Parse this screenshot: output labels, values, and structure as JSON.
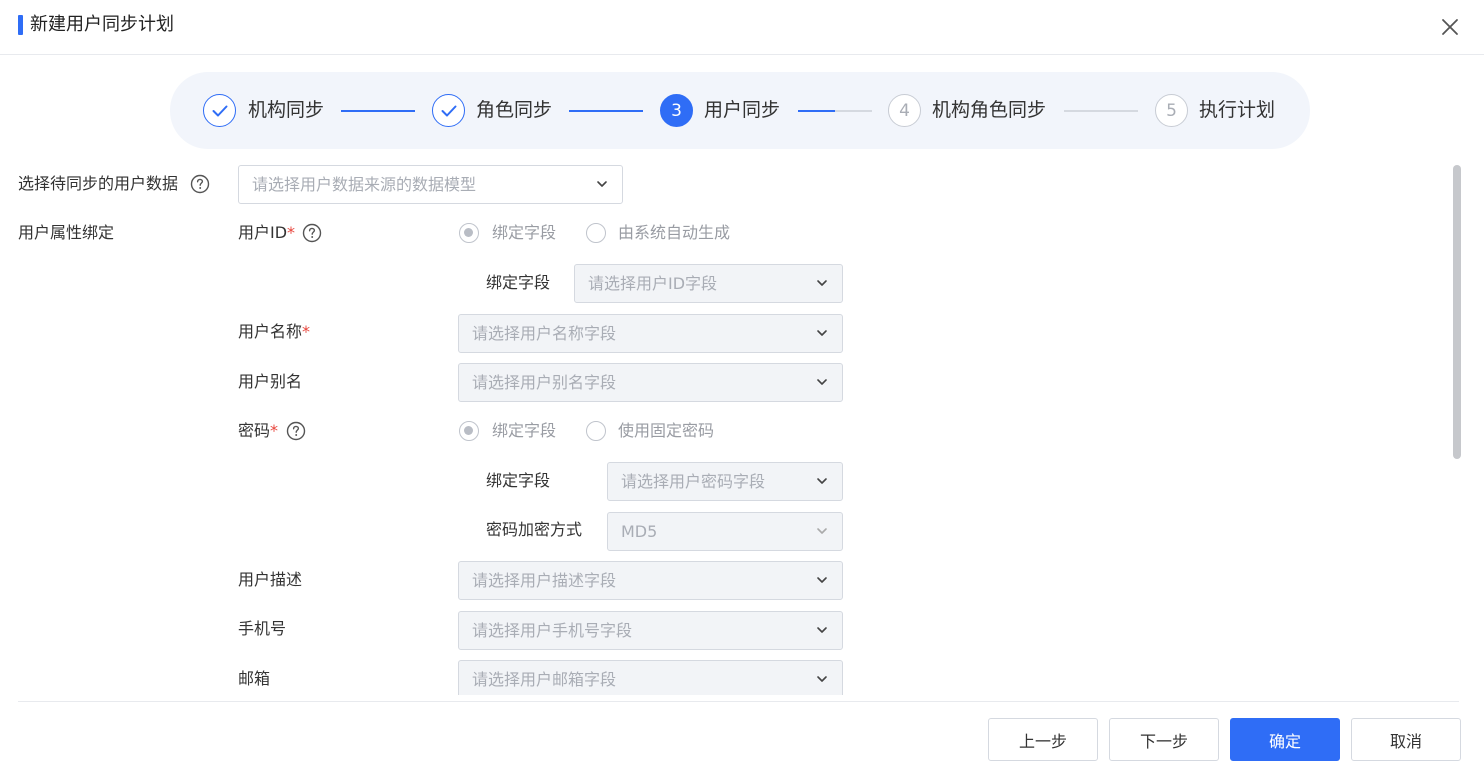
{
  "dialog": {
    "title": "新建用户同步计划"
  },
  "steps": [
    {
      "label": "机构同步",
      "state": "done",
      "icon": "check-icon"
    },
    {
      "label": "角色同步",
      "state": "done",
      "icon": "check-icon"
    },
    {
      "number": "3",
      "label": "用户同步",
      "state": "active"
    },
    {
      "number": "4",
      "label": "机构角色同步",
      "state": "pending"
    },
    {
      "number": "5",
      "label": "执行计划",
      "state": "pending"
    }
  ],
  "form": {
    "data_source": {
      "label": "选择待同步的用户数据",
      "placeholder": "请选择用户数据来源的数据模型"
    },
    "attr_binding_label": "用户属性绑定",
    "user_id": {
      "label": "用户ID",
      "required_mark": "*",
      "options": [
        "绑定字段",
        "由系统自动生成"
      ],
      "selected": "绑定字段",
      "bind_label": "绑定字段",
      "bind_placeholder": "请选择用户ID字段"
    },
    "user_name": {
      "label": "用户名称",
      "required_mark": "*",
      "placeholder": "请选择用户名称字段"
    },
    "user_alias": {
      "label": "用户别名",
      "placeholder": "请选择用户别名字段"
    },
    "password": {
      "label": "密码",
      "required_mark": "*",
      "options": [
        "绑定字段",
        "使用固定密码"
      ],
      "selected": "绑定字段",
      "bind_label": "绑定字段",
      "bind_placeholder": "请选择用户密码字段",
      "encrypt_label": "密码加密方式",
      "encrypt_value": "MD5"
    },
    "user_desc": {
      "label": "用户描述",
      "placeholder": "请选择用户描述字段"
    },
    "phone": {
      "label": "手机号",
      "placeholder": "请选择用户手机号字段"
    },
    "email": {
      "label": "邮箱",
      "placeholder": "请选择用户邮箱字段"
    }
  },
  "footer": {
    "prev": "上一步",
    "next": "下一步",
    "confirm": "确定",
    "cancel": "取消"
  },
  "colors": {
    "accent": "#2f6df6",
    "required": "#e8453c"
  }
}
